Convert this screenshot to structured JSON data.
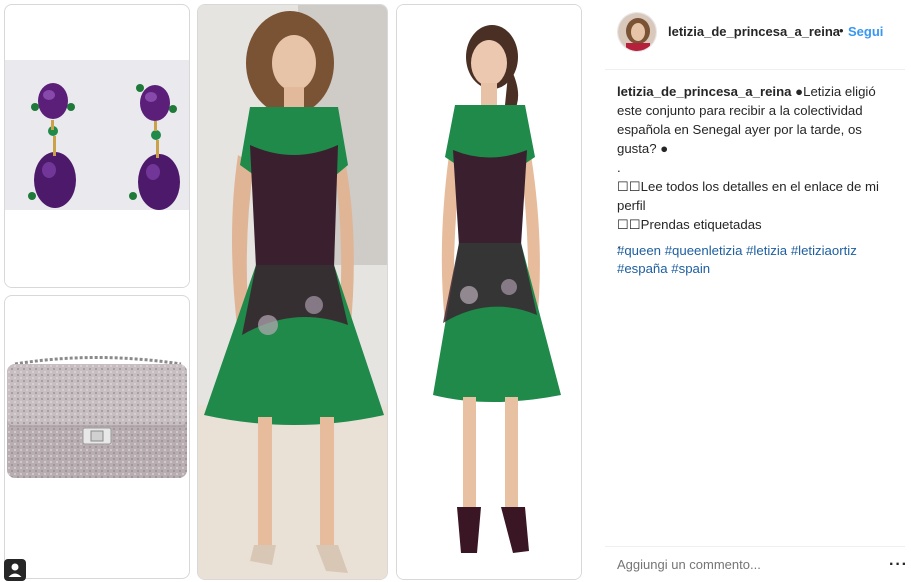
{
  "post": {
    "username": "letizia_de_princesa_a_reina",
    "separator": "•",
    "follow_label": "Segui",
    "caption": {
      "author": "letizia_de_princesa_a_reina",
      "lines": [
        "●Letizia eligió",
        "este conjunto para recibir a la colectividad",
        "española en Senegal ayer por la tarde, os",
        "gusta? ●",
        ".",
        "☐☐Lee todos los detalles en el enlace de mi",
        "perfil",
        "☐☐Prendas etiquetadas",
        "."
      ],
      "hashtags": [
        "#queen",
        "#queenletizia",
        "#letizia",
        "#letiziaortiz",
        "#españa",
        "#spain"
      ]
    },
    "comment_placeholder": "Aggiungi un commento...",
    "more_icon": "···"
  },
  "icons": {
    "tagged": "user-tag-icon",
    "more": "more-options-icon"
  },
  "colors": {
    "link": "#3897f0",
    "hashtag": "#1e5fa0",
    "dress_green": "#1f8a4a",
    "dress_lace": "#3a1f2e",
    "gem_purple": "#6a2a8c"
  }
}
